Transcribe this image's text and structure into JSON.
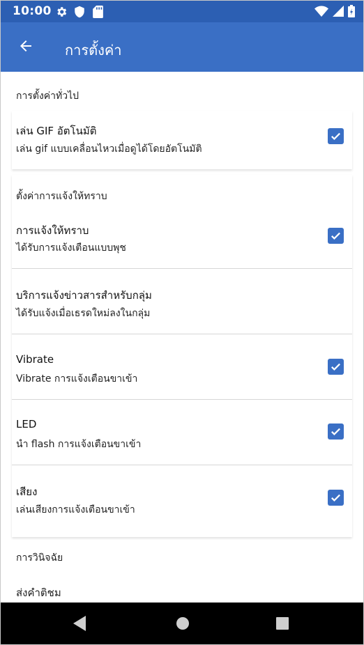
{
  "status_bar": {
    "time": "10:00",
    "left_icons": [
      "gear-icon",
      "shield-icon",
      "sd-card-icon"
    ],
    "right_icons": [
      "wifi-icon",
      "signal-icon",
      "battery-icon"
    ]
  },
  "app_bar": {
    "title": "การตั้งค่า",
    "back_icon": "arrow-back-icon"
  },
  "sections": {
    "general": {
      "header": "การตั้งค่าทั่วไป",
      "autoplay_gif": {
        "title": "เล่น GIF อัตโนมัติ",
        "summary": "เล่น gif แบบเคลื่อนไหวเมื่อดูได้โดยอัตโนมัติ",
        "checked": true
      }
    },
    "notifications": {
      "header": "ตั้งค่าการแจ้งให้ทราบ",
      "notifications": {
        "title": "การแจ้งให้ทราบ",
        "summary": "ได้รับการแจ้งเตือนแบบพุช",
        "checked": true
      },
      "group_news": {
        "title": "บริการแจ้งข่าวสารสำหรับกลุ่ม",
        "summary": "ได้รับแจ้งเมื่อเธรดใหม่ลงในกลุ่ม"
      },
      "vibrate": {
        "title": "Vibrate",
        "summary": "Vibrate การแจ้งเตือนขาเข้า",
        "checked": true
      },
      "led": {
        "title": "LED",
        "summary": "นำ flash การแจ้งเตือนขาเข้า",
        "checked": true
      },
      "sound": {
        "title": "เสียง",
        "summary": "เล่นเสียงการแจ้งเตือนขาเข้า",
        "checked": true
      }
    },
    "diagnostics": {
      "header": "การวินิจฉัย",
      "send_feedback": "ส่งคำติชม"
    }
  },
  "colors": {
    "status_bar": "#2c5fb3",
    "app_bar": "#3a6fc5",
    "checkbox": "#3a6fc5",
    "nav_bar": "#000000"
  },
  "nav_bar": {
    "icons": [
      "back-triangle-icon",
      "home-circle-icon",
      "recents-square-icon"
    ]
  }
}
